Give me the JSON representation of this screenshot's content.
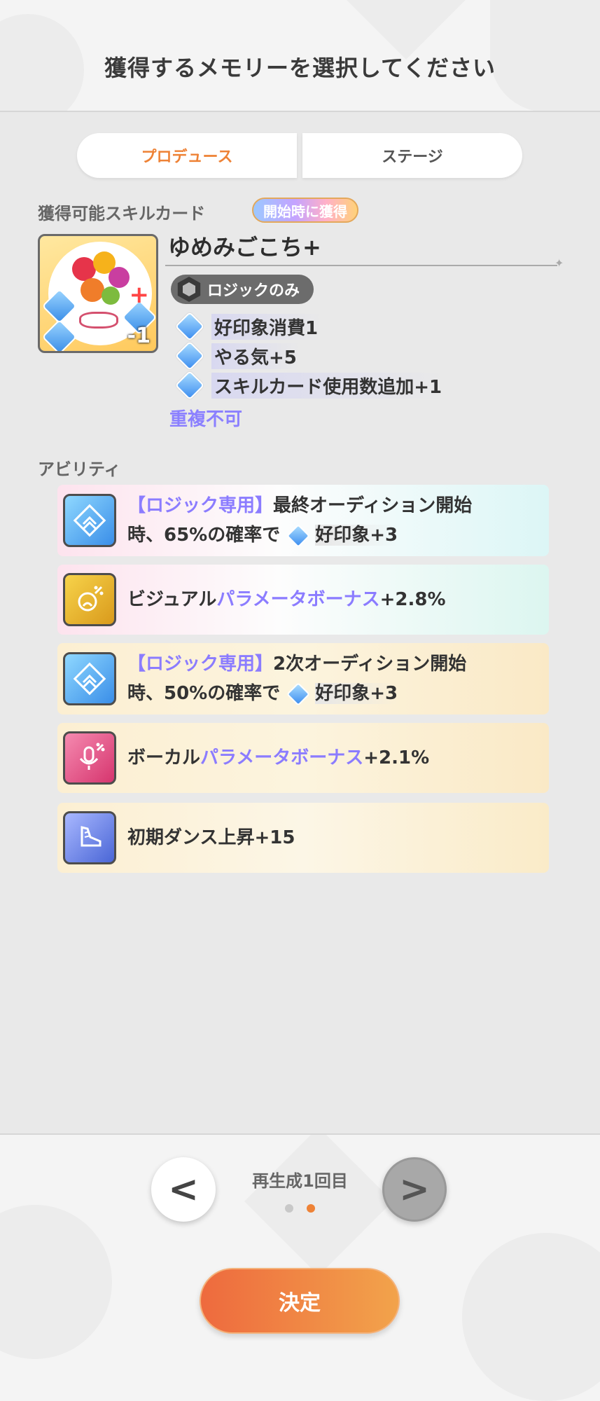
{
  "header": {
    "title": "獲得するメモリーを選択してください"
  },
  "tabs": [
    {
      "label": "プロデュース",
      "active": true
    },
    {
      "label": "ステージ",
      "active": false
    }
  ],
  "skill_card": {
    "section_label": "獲得可能スキルカード",
    "badge": "開始時に獲得",
    "name": "ゆめみごこち+",
    "cost": "-1",
    "plan_tag": "ロジックのみ",
    "effects": [
      {
        "icon": "thumbs-up-icon",
        "text": "好印象消費1"
      },
      {
        "icon": "fist-icon",
        "text": "やる気+5"
      },
      {
        "icon": "plus-one-card-icon",
        "text": "スキルカード使用数追加+1"
      }
    ],
    "note": "重複不可"
  },
  "abilities_label": "アビリティ",
  "abilities": [
    {
      "icon": "double-chevron-up-icon",
      "prefix": "【ロジック専用】",
      "line1": "最終オーディション開始",
      "line2a": "時、65%の確率で",
      "effect": "好印象+3"
    },
    {
      "icon": "visual-param-icon",
      "text_a": "ビジュアル",
      "highlight": "パラメータボーナス",
      "text_b": "+2.8%"
    },
    {
      "icon": "double-chevron-up-icon",
      "prefix": "【ロジック専用】",
      "line1": "2次オーディション開始",
      "line2a": "時、50%の確率で",
      "effect": "好印象+3"
    },
    {
      "icon": "microphone-icon",
      "text_a": "ボーカル",
      "highlight": "パラメータボーナス",
      "text_b": "+2.1%"
    },
    {
      "icon": "dance-shoe-icon",
      "text": "初期ダンス上昇+15"
    }
  ],
  "footer": {
    "regen_text": "再生成1回目",
    "prev_symbol": "<",
    "next_symbol": ">",
    "confirm_label": "決定",
    "page_count": 2,
    "current_page": 2
  },
  "colors": {
    "accent": "#ee8236",
    "highlight": "#8b7cff",
    "confirm_start": "#ee6a3e",
    "confirm_end": "#f2a34b"
  }
}
